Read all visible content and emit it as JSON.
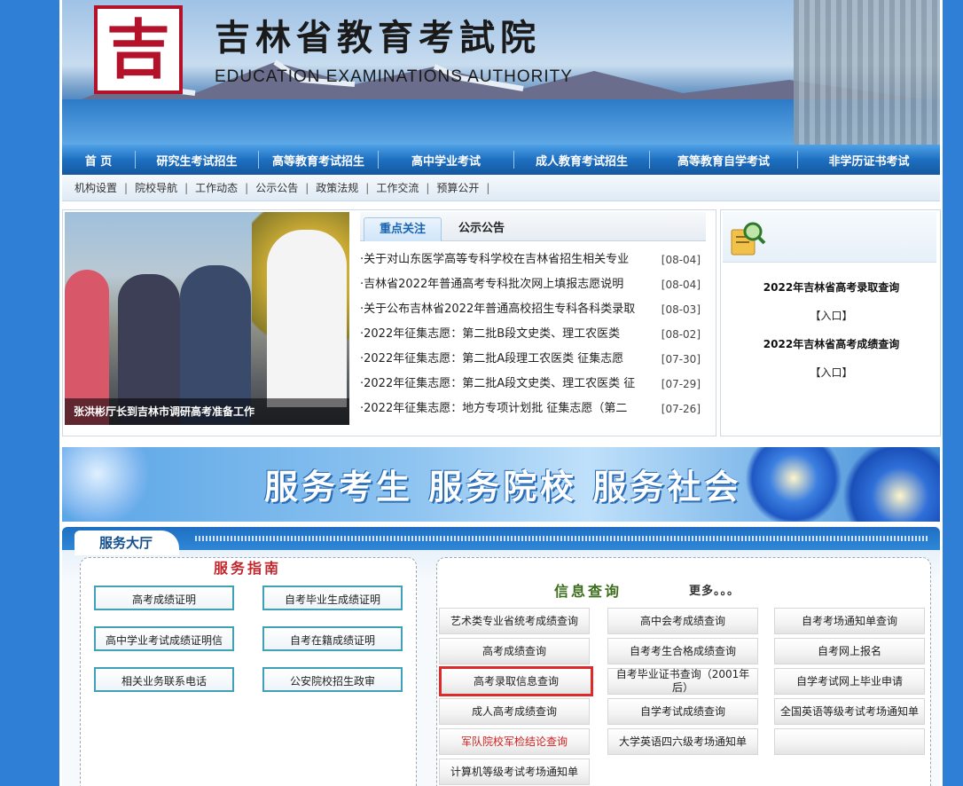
{
  "header": {
    "logo_char": "吉",
    "title_cn": "吉林省教育考試院",
    "title_en": "EDUCATION EXAMINATIONS AUTHORITY"
  },
  "main_nav": [
    {
      "label": "首 页"
    },
    {
      "label": "研究生考试招生"
    },
    {
      "label": "高等教育考试招生"
    },
    {
      "label": "高中学业考试"
    },
    {
      "label": "成人教育考试招生"
    },
    {
      "label": "高等教育自学考试"
    },
    {
      "label": "非学历证书考试"
    }
  ],
  "sub_nav": [
    {
      "label": "机构设置"
    },
    {
      "label": "院校导航"
    },
    {
      "label": "工作动态"
    },
    {
      "label": "公示公告"
    },
    {
      "label": "政策法规"
    },
    {
      "label": "工作交流"
    },
    {
      "label": "预算公开"
    }
  ],
  "sub_nav_separator": "|",
  "photo": {
    "caption": "张洪彬厅长到吉林市调研高考准备工作"
  },
  "news_tabs": {
    "active": "重点关注",
    "other": "公示公告"
  },
  "news": [
    {
      "title": "·关于对山东医学高等专科学校在吉林省招生相关专业",
      "date": "[08-04]"
    },
    {
      "title": "·吉林省2022年普通高考专科批次网上填报志愿说明",
      "date": "[08-04]"
    },
    {
      "title": "·关于公布吉林省2022年普通高校招生专科各科类录取",
      "date": "[08-03]"
    },
    {
      "title": "·2022年征集志愿：第二批B段文史类、理工农医类",
      "date": "[08-02]"
    },
    {
      "title": "·2022年征集志愿：第二批A段理工农医类 征集志愿",
      "date": "[07-30]"
    },
    {
      "title": "·2022年征集志愿：第二批A段文史类、理工农医类 征",
      "date": "[07-29]"
    },
    {
      "title": "·2022年征集志愿：地方专项计划批 征集志愿（第二",
      "date": "[07-26]"
    }
  ],
  "query_box": {
    "item1_title": "2022年吉林省高考录取查询",
    "item1_link": "【入口】",
    "item2_title": "2022年吉林省高考成绩查询",
    "item2_link": "【入口】"
  },
  "slogan": "服务考生 服务院校 服务社会",
  "hall": {
    "title": "服务大厅",
    "guide": {
      "title": "服务指南",
      "buttons": [
        {
          "label": "高考成绩证明"
        },
        {
          "label": "自考毕业生成绩证明"
        },
        {
          "label": "高中学业考试成绩证明信"
        },
        {
          "label": "自考在籍成绩证明"
        },
        {
          "label": "相关业务联系电话"
        },
        {
          "label": "公安院校招生政审"
        }
      ]
    },
    "info": {
      "title": "信息查询",
      "more": "更多。。。",
      "buttons": [
        {
          "label": "艺术类专业省统考成绩查询"
        },
        {
          "label": "高中会考成绩查询"
        },
        {
          "label": "自考考场通知单查询"
        },
        {
          "label": "高考成绩查询"
        },
        {
          "label": "自考考生合格成绩查询"
        },
        {
          "label": "自考网上报名"
        },
        {
          "label": "高考录取信息查询",
          "highlighted": true
        },
        {
          "label": "自考毕业证书查询（2001年后）"
        },
        {
          "label": "自学考试网上毕业申请"
        },
        {
          "label": "成人高考成绩查询"
        },
        {
          "label": "自学考试成绩查询"
        },
        {
          "label": "全国英语等级考试考场通知单"
        },
        {
          "label": "军队院校军检结论查询",
          "color": "#d12020"
        },
        {
          "label": "大学英语四六级考场通知单"
        },
        {
          "label": ""
        },
        {
          "label": "计算机等级考试考场通知单"
        }
      ]
    }
  },
  "colors": {
    "nav_blue": "#1e6fc2",
    "guide_title_red": "#c0262c",
    "info_title_green": "#3c6e1e",
    "highlight_red": "#e02a2a"
  }
}
